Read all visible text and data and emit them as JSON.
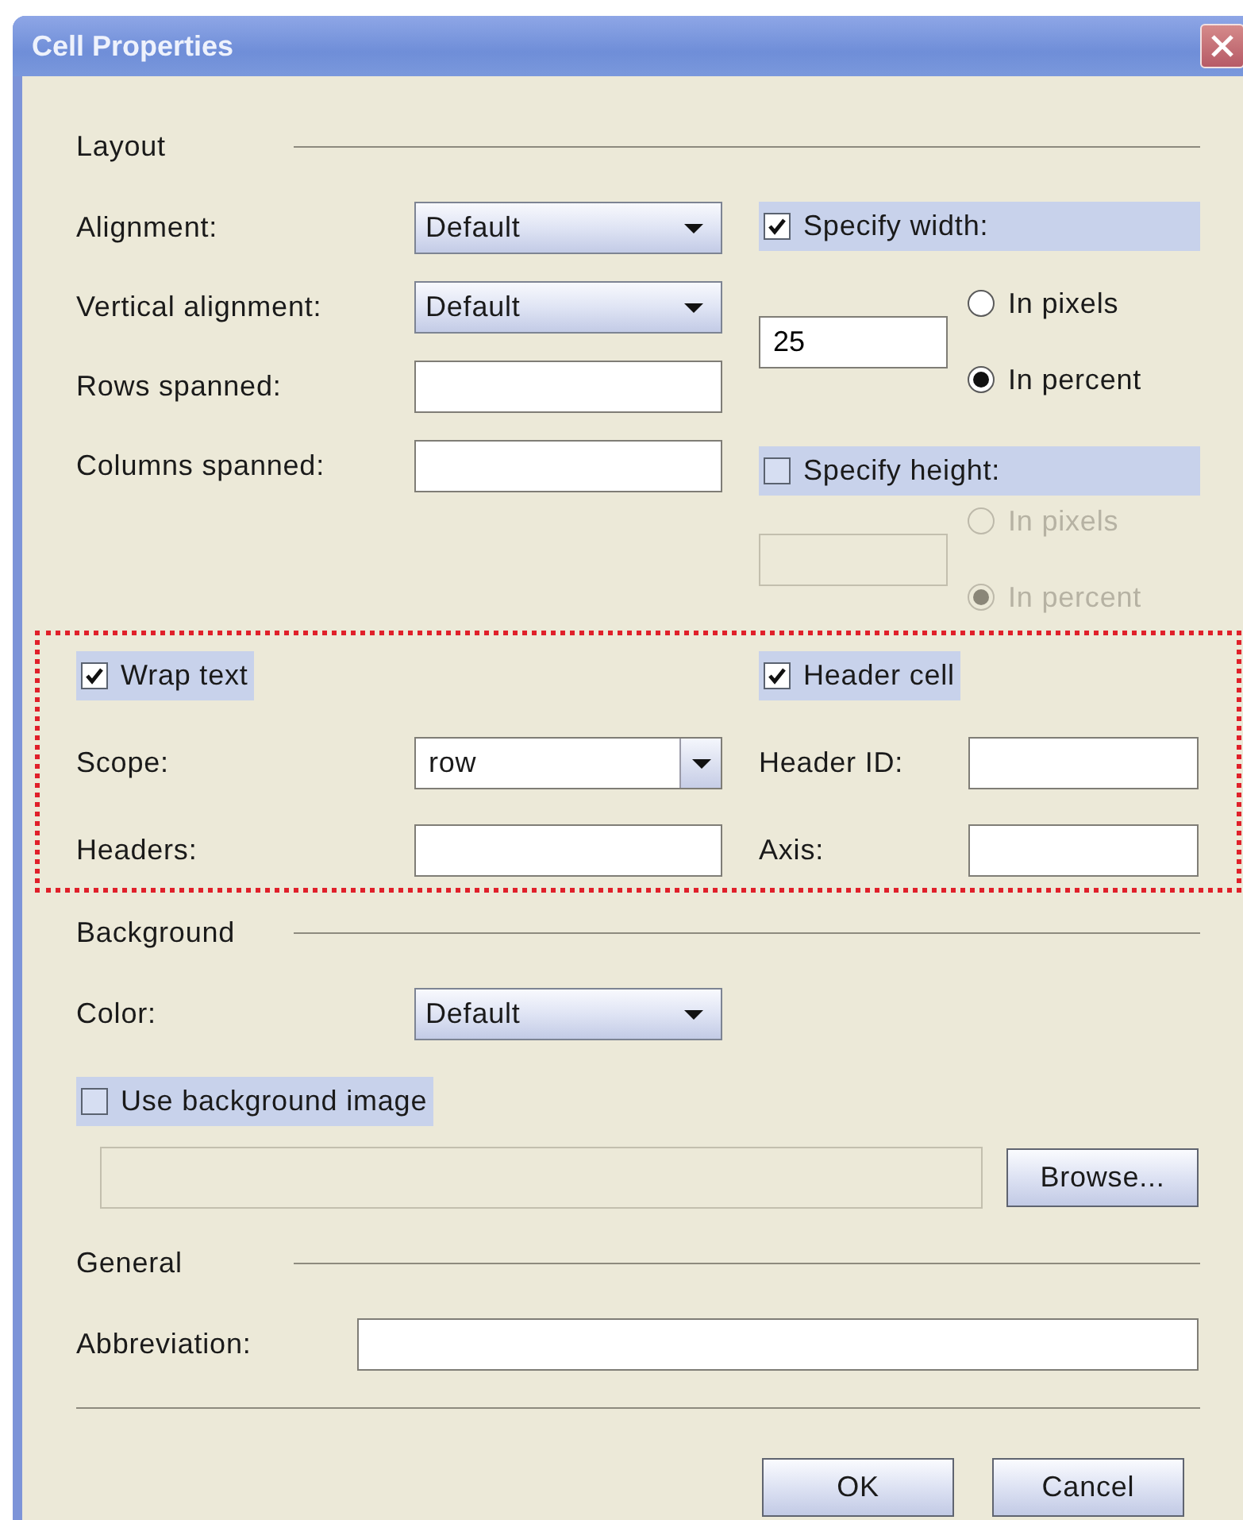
{
  "window": {
    "title": "Cell Properties"
  },
  "layout": {
    "heading": "Layout",
    "fields": [
      {
        "kind": "dropdown",
        "label": "Alignment:",
        "value": "Default"
      },
      {
        "kind": "dropdown",
        "label": "Vertical alignment:",
        "value": "Default"
      },
      {
        "kind": "text",
        "label": "Rows spanned:"
      },
      {
        "kind": "text",
        "label": "Columns spanned:"
      }
    ],
    "specify_width": {
      "label": "Specify width:",
      "checked": true,
      "value": "25",
      "disabled": false,
      "units": [
        {
          "label": "In pixels",
          "selected": false
        },
        {
          "label": "In percent",
          "selected": true
        }
      ]
    },
    "specify_height": {
      "label": "Specify height:",
      "checked": false,
      "disabled": true,
      "units": [
        {
          "label": "In pixels",
          "selected": false
        },
        {
          "label": "In percent",
          "selected": true
        }
      ]
    }
  },
  "accessibility": {
    "highlighted": true,
    "wrap_text": {
      "label": "Wrap text",
      "checked": true
    },
    "header_cell": {
      "label": "Header cell",
      "checked": true
    },
    "scope": {
      "label": "Scope:",
      "value": "row"
    },
    "headers": {
      "label": "Headers:"
    },
    "header_id": {
      "label": "Header ID:"
    },
    "axis": {
      "label": "Axis:"
    }
  },
  "background": {
    "heading": "Background",
    "color": {
      "label": "Color:",
      "value": "Default"
    },
    "use_image": {
      "label": "Use background image",
      "checked": false
    },
    "image_path": {
      "disabled": true
    },
    "browse": "Browse..."
  },
  "general": {
    "heading": "General",
    "abbreviation": {
      "label": "Abbreviation:"
    }
  },
  "buttons": [
    {
      "label": "OK"
    },
    {
      "label": "Cancel"
    }
  ]
}
